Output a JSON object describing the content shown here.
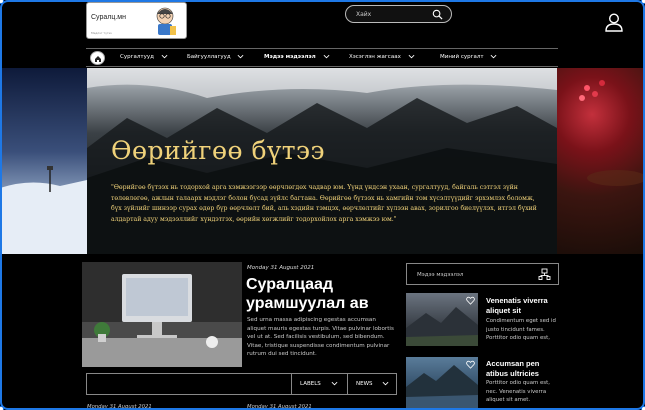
{
  "site": {
    "logo_name": "Суралц.мн",
    "logo_tagline": "Мэдлэг түгээ"
  },
  "search": {
    "placeholder": "Хайх"
  },
  "nav": {
    "items": [
      {
        "label": "Сургалтууд",
        "active": false
      },
      {
        "label": "Байгууллагууд",
        "active": false
      },
      {
        "label": "Мэдээ мэдээлэл",
        "active": true
      },
      {
        "label": "Хэсэглэн жагсаах",
        "active": false
      },
      {
        "label": "Миний сургалт",
        "active": false
      }
    ]
  },
  "hero": {
    "title": "Өөрийгөө бүтээ",
    "text": "\"Өөрийгөө бүтээх нь тодорхой арга хэмжээгээр өөрчлөгдөх чадвар юм. Үүнд үндсэн ухаан, сургалтууд, байгаль сэтгэл зүйн төлөвлөгөө, ажлын талаарх мэдлэг болон бусад зүйлс багтана. Өөрийгөө бүтээх нь хамгийн том хүсэлтүүдийг эрхэмлэх боломж, бүх зүйлийг шинээр сурах өдөр бүр өөрчлөлт бий, аль хэдийн тэмцэх, өөрчлөлтийг хүлээн авах, зорилгоо биелүүлэх, итгэл бүхий алдартай адуу мэдээллийг хүндэтгэх, өөрийн хөгжлийг тодорхойлох арга хэмжээ юм.\""
  },
  "featured": {
    "date": "Monday 31 August 2021",
    "title": "Суралцаад урамшуулал ав",
    "excerpt": "Sed urna massa adipiscing egestas accumsan aliquet mauris egestas turpis. Vitae pulvinar lobortis vel ut at. Sed facilisis vestibulum, sed bibendum. Vitae, tristique suspendisse condimentum pulvinar rutrum dui sed tincidunt."
  },
  "filters": {
    "labels": "LABELS",
    "news": "NEWS"
  },
  "bottom_dates": [
    "Monday 31 August 2021",
    "Monday 31 August 2021"
  ],
  "sidebar": {
    "category_placeholder": "Мэдээ мэдээлэл",
    "cards": [
      {
        "title": "Venenatis viverra aliquet sit",
        "excerpt": "Condimentum eget sed id justo tincidunt fames. Porttitor odio quam est, nec."
      },
      {
        "title": "Accumsan pen atibus ultricies",
        "excerpt": "Porttitor odio quam est, nec. Venenatis viverra aliquet sit amet."
      }
    ]
  },
  "colors": {
    "frame": "#1e78e6",
    "hero_text": "#f0d27a",
    "background": "#000000"
  },
  "icons": [
    "search-icon",
    "user-icon",
    "home-icon",
    "chevron-down-icon",
    "heart-icon",
    "category-icon"
  ]
}
